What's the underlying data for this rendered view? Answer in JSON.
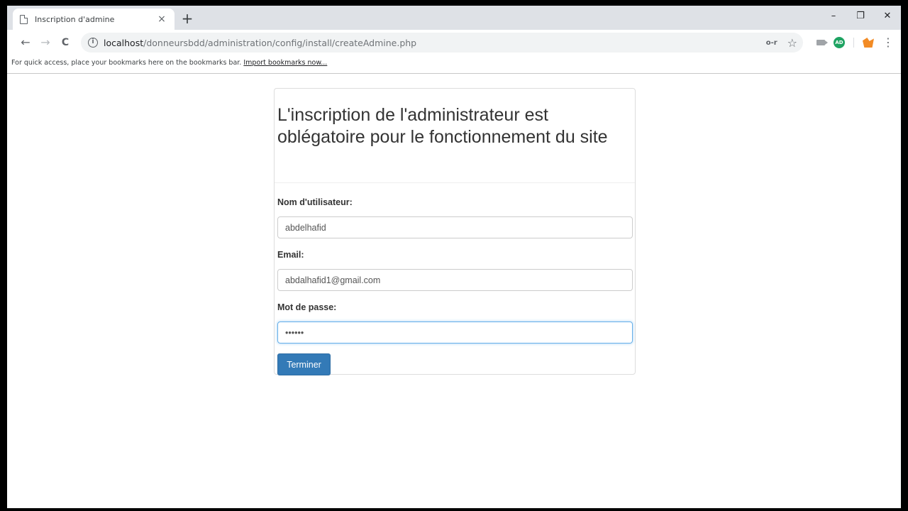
{
  "browser": {
    "tab": {
      "title": "Inscription d'admine",
      "close": "×"
    },
    "new_tab": "+",
    "window_controls": {
      "minimize": "–",
      "restore": "❐",
      "close": "✕"
    },
    "nav": {
      "back": "←",
      "forward": "→",
      "reload": "C"
    },
    "address": {
      "host": "localhost",
      "path": "/donneursbdd/administration/config/install/createAdmine.php"
    },
    "omnibox_icons": {
      "key": "o-r",
      "star": "☆"
    },
    "extensions": {
      "adblock_label": "AD",
      "menu": "⋮"
    },
    "bookmarks_bar": {
      "text": "For quick access, place your bookmarks here on the bookmarks bar.",
      "link": "Import bookmarks now..."
    }
  },
  "form": {
    "heading": "L'inscription de l'administrateur est oblégatoire pour le fonctionnement du site",
    "username": {
      "label": "Nom d'utilisateur:",
      "value": "abdelhafid"
    },
    "email": {
      "label": "Email:",
      "value": "abdalhafid1@gmail.com"
    },
    "password": {
      "label": "Mot de passe:",
      "value": "••••••"
    },
    "submit_label": "Terminer"
  },
  "colors": {
    "primary_button": "#337ab7",
    "focus_border": "#66afe9",
    "tabstrip": "#dee1e6"
  }
}
